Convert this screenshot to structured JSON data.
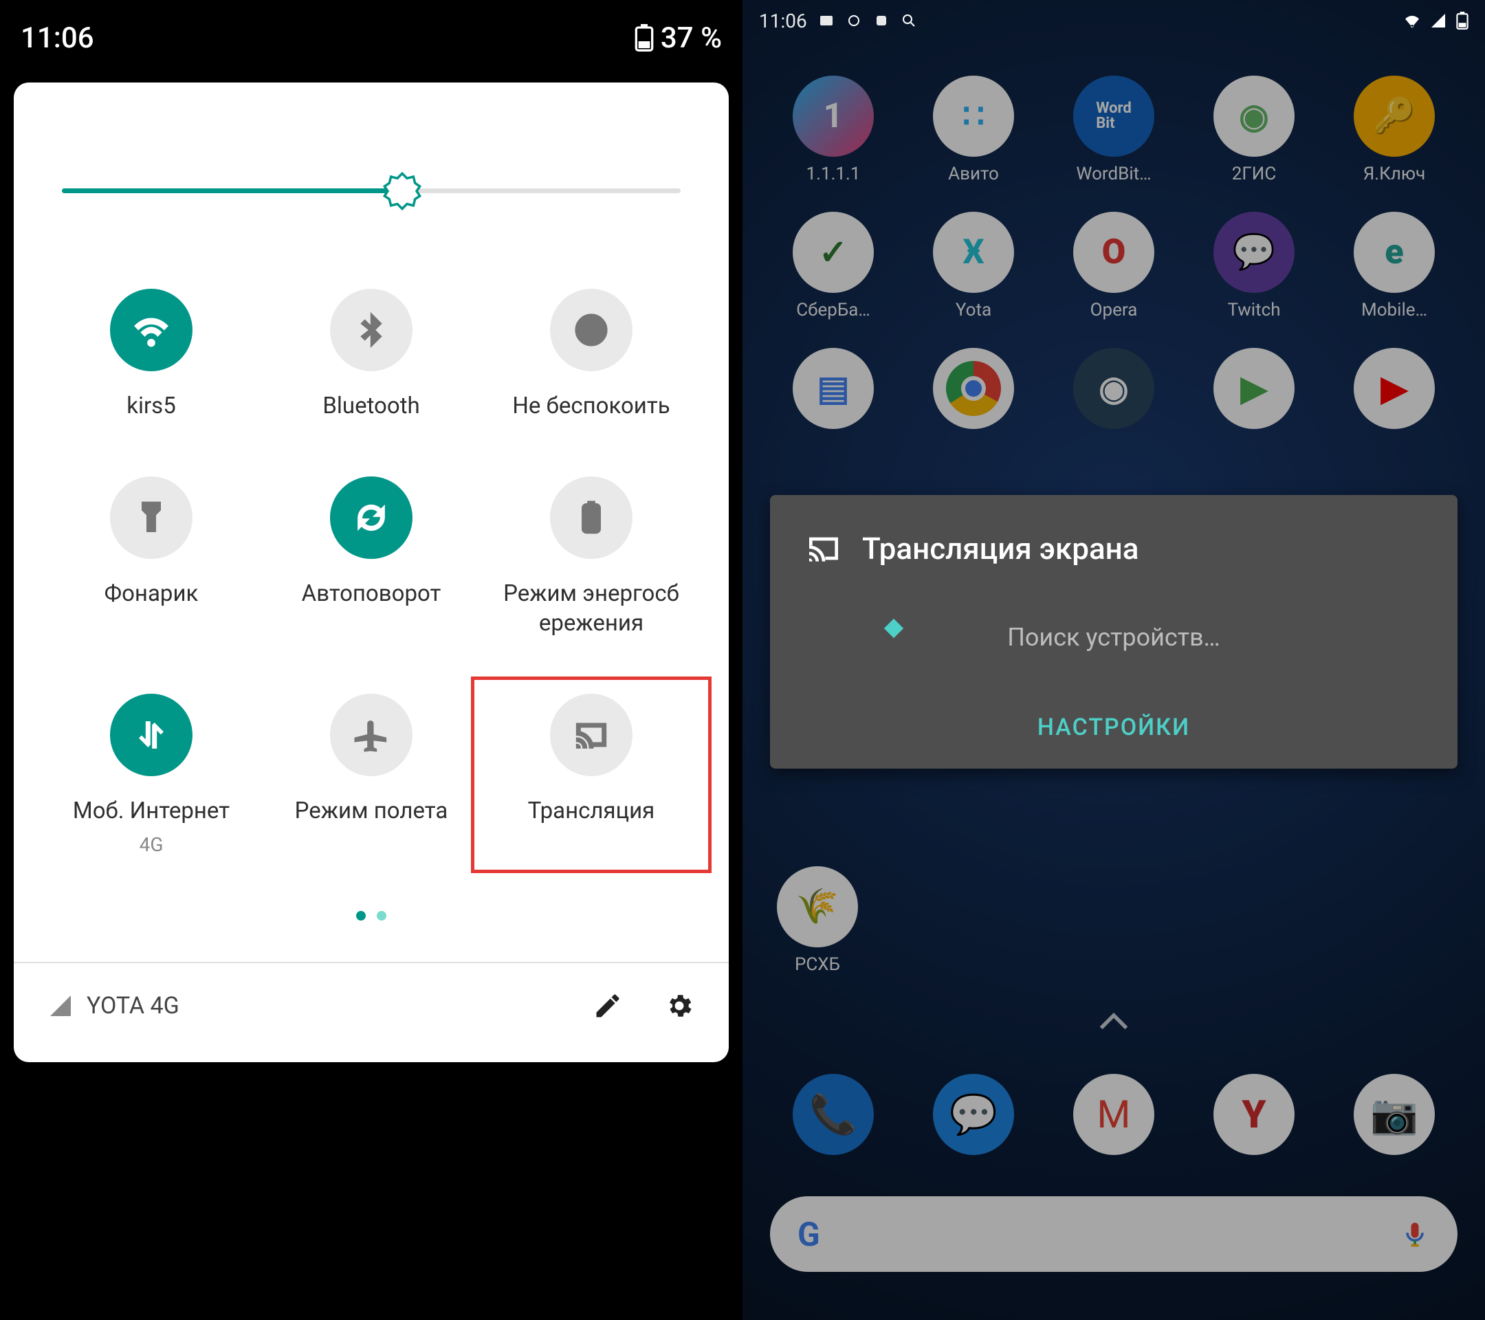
{
  "left": {
    "status": {
      "time": "11:06",
      "battery": "37 %"
    },
    "brightness_percent": 55,
    "tiles": [
      {
        "name": "wifi",
        "label": "kirs5",
        "active": true
      },
      {
        "name": "bluetooth",
        "label": "Bluetooth",
        "active": false
      },
      {
        "name": "dnd",
        "label": "Не беспокоить",
        "active": false
      },
      {
        "name": "flashlight",
        "label": "Фонарик",
        "active": false
      },
      {
        "name": "autorotate",
        "label": "Автоповорот",
        "active": true
      },
      {
        "name": "battery-saver",
        "label": "Режим энергосб ережения",
        "active": false
      },
      {
        "name": "mobile-data",
        "label": "Моб. Интернет",
        "sublabel": "4G",
        "active": true
      },
      {
        "name": "airplane",
        "label": "Режим полета",
        "active": false
      },
      {
        "name": "cast",
        "label": "Трансляция",
        "active": false,
        "highlighted": true
      }
    ],
    "footer": {
      "carrier": "YOTA 4G"
    }
  },
  "right": {
    "status": {
      "time": "11:06"
    },
    "apps_row1": [
      {
        "label": "1.1.1.1",
        "bg": "linear-gradient(135deg,#ff4081,#f8bbd0)",
        "text": "1⁴"
      },
      {
        "label": "Авито",
        "bg": "#fff",
        "text": "⠶"
      },
      {
        "label": "WordBit…",
        "bg": "#1565c0",
        "text": "Word Bit"
      },
      {
        "label": "2ГИС",
        "bg": "#fff",
        "text": "◯"
      },
      {
        "label": "Я.Ключ",
        "bg": "#ffb300",
        "text": "🔑"
      }
    ],
    "apps_row2": [
      {
        "label": "СберБа…",
        "bg": "#fff",
        "text": "✓"
      },
      {
        "label": "Yota",
        "bg": "#fff",
        "text": "Ӿ"
      },
      {
        "label": "Opera",
        "bg": "#fff",
        "text": "O"
      },
      {
        "label": "Twitch",
        "bg": "#6441a5",
        "text": "⟅⟆"
      },
      {
        "label": "Mobile…",
        "bg": "#fff",
        "text": "e"
      }
    ],
    "rshb_label": "РСХБ",
    "cast_dialog": {
      "title": "Трансляция экрана",
      "body": "Поиск устройств…",
      "action": "НАСТРОЙКИ"
    }
  }
}
